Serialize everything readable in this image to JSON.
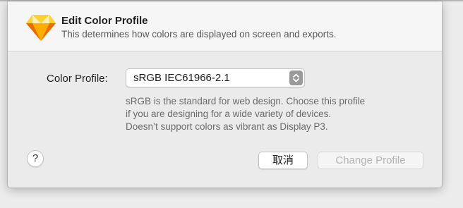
{
  "dialog": {
    "title": "Edit Color Profile",
    "subtitle": "This determines how colors are displayed on screen and exports.",
    "app_icon": "sketch-diamond-icon"
  },
  "form": {
    "color_profile_label": "Color Profile:",
    "color_profile_value": "sRGB IEC61966-2.1",
    "description_lines": [
      "sRGB is the standard for web design. Choose this profile",
      "if you are designing for a wide variety of devices.",
      "Doesn’t support colors as vibrant as Display P3."
    ]
  },
  "buttons": {
    "help_label": "?",
    "cancel_label": "取消",
    "change_profile_label": "Change Profile"
  },
  "colors": {
    "sketch_orange": "#f7a823",
    "sketch_yellow": "#fdd231",
    "disabled_text": "#b4b4b4"
  }
}
